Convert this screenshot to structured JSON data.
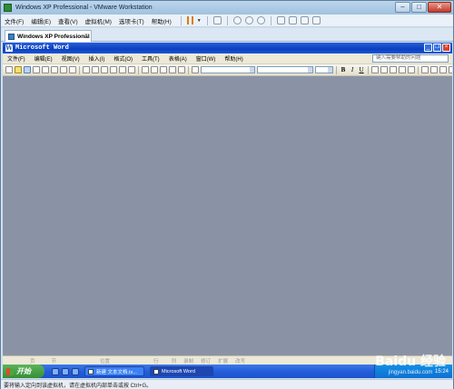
{
  "vmware": {
    "title": "Windows XP Professional - VMware Workstation",
    "window_controls": [
      "–",
      "□",
      "✕"
    ],
    "menu": [
      "文件(F)",
      "编辑(E)",
      "查看(V)",
      "虚拟机(M)",
      "选项卡(T)",
      "帮助(H)"
    ],
    "tab_label": "Windows XP Professional",
    "tab_close": "×",
    "status_text": "要将输入定向到该虚拟机，请在虚拟机内部单击或按 Ctrl+G。"
  },
  "word": {
    "title": "Microsoft Word",
    "menu": [
      "文件(F)",
      "编辑(E)",
      "视图(V)",
      "插入(I)",
      "格式(O)",
      "工具(T)",
      "表格(A)",
      "窗口(W)",
      "帮助(H)"
    ],
    "help_placeholder": "键入需要帮助的问题",
    "toolbar_letters": [
      "B",
      "I",
      "U"
    ],
    "status_cells": [
      "页",
      "节",
      "位置",
      "行",
      "列",
      "录制",
      "修订",
      "扩展",
      "改写"
    ]
  },
  "taskbar": {
    "start_label": "开始",
    "tasks": [
      "新建 文本文档.tx...",
      "Microsoft Word"
    ],
    "clock": "15:24"
  },
  "watermark": {
    "logo": "Baidu 经验",
    "url": "jingyan.baidu.com"
  },
  "colors": {
    "xp_title_blue": "#0a3fc0",
    "doc_background": "#8a93a5",
    "start_green": "#358f35"
  }
}
